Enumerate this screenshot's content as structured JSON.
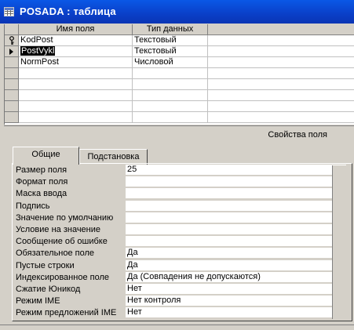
{
  "window": {
    "title": "POSADA : таблица"
  },
  "grid": {
    "headers": [
      "Имя поля",
      "Тип данных",
      ""
    ],
    "rows": [
      {
        "name": "KodPost",
        "type": "Текстовый",
        "key": true
      },
      {
        "name": "PostVykl",
        "type": "Текстовый",
        "current": true
      },
      {
        "name": "NormPost",
        "type": "Числовой"
      },
      {
        "name": "",
        "type": ""
      },
      {
        "name": "",
        "type": ""
      },
      {
        "name": "",
        "type": ""
      },
      {
        "name": "",
        "type": ""
      },
      {
        "name": "",
        "type": ""
      }
    ]
  },
  "properties": {
    "section_label": "Свойства поля",
    "tabs": [
      "Общие",
      "Подстановка"
    ],
    "active_tab": "Общие",
    "items": [
      {
        "label": "Размер поля",
        "value": "25"
      },
      {
        "label": "Формат поля",
        "value": ""
      },
      {
        "label": "Маска ввода",
        "value": ""
      },
      {
        "label": "Подпись",
        "value": ""
      },
      {
        "label": "Значение по умолчанию",
        "value": ""
      },
      {
        "label": "Условие на значение",
        "value": ""
      },
      {
        "label": "Сообщение об ошибке",
        "value": ""
      },
      {
        "label": "Обязательное поле",
        "value": "Да"
      },
      {
        "label": "Пустые строки",
        "value": "Да"
      },
      {
        "label": "Индексированное поле",
        "value": "Да (Совпадения не допускаются)"
      },
      {
        "label": "Сжатие Юникод",
        "value": "Нет"
      },
      {
        "label": "Режим IME",
        "value": "Нет контроля"
      },
      {
        "label": "Режим предложений IME",
        "value": "Нет"
      }
    ]
  }
}
